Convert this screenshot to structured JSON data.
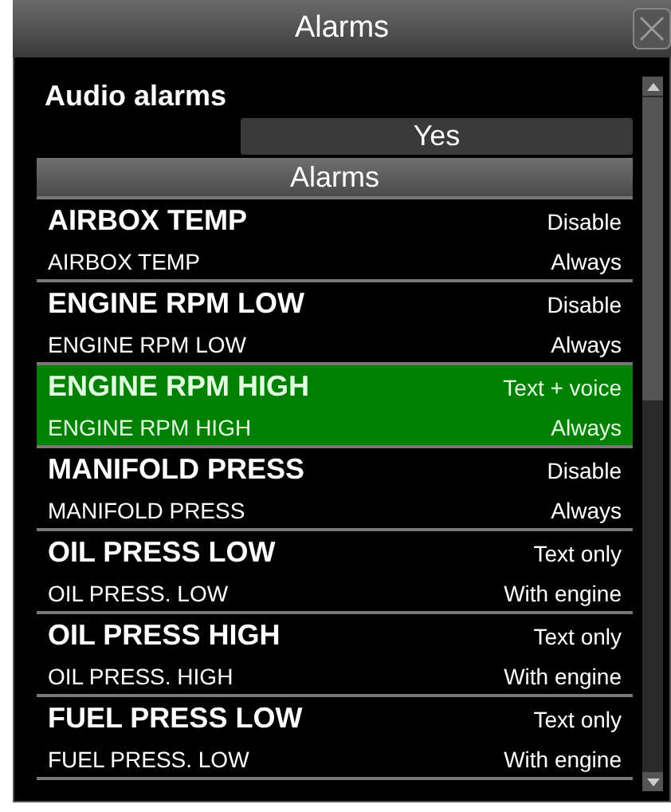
{
  "window": {
    "title": "Alarms"
  },
  "audio_alarms": {
    "label": "Audio alarms",
    "value": "Yes"
  },
  "section": {
    "title": "Alarms"
  },
  "alarms": [
    {
      "name": "AIRBOX TEMP",
      "mode": "Disable",
      "message": "AIRBOX TEMP",
      "condition": "Always",
      "selected": false
    },
    {
      "name": "ENGINE RPM LOW",
      "mode": "Disable",
      "message": "ENGINE RPM LOW",
      "condition": "Always",
      "selected": false
    },
    {
      "name": "ENGINE RPM HIGH",
      "mode": "Text + voice",
      "message": "ENGINE RPM HIGH",
      "condition": "Always",
      "selected": true
    },
    {
      "name": "MANIFOLD PRESS",
      "mode": "Disable",
      "message": "MANIFOLD PRESS",
      "condition": "Always",
      "selected": false
    },
    {
      "name": "OIL PRESS LOW",
      "mode": "Text only",
      "message": "OIL PRESS. LOW",
      "condition": "With engine",
      "selected": false
    },
    {
      "name": "OIL PRESS HIGH",
      "mode": "Text only",
      "message": "OIL PRESS. HIGH",
      "condition": "With engine",
      "selected": false
    },
    {
      "name": "FUEL PRESS LOW",
      "mode": "Text only",
      "message": "FUEL PRESS. LOW",
      "condition": "With engine",
      "selected": false
    }
  ]
}
